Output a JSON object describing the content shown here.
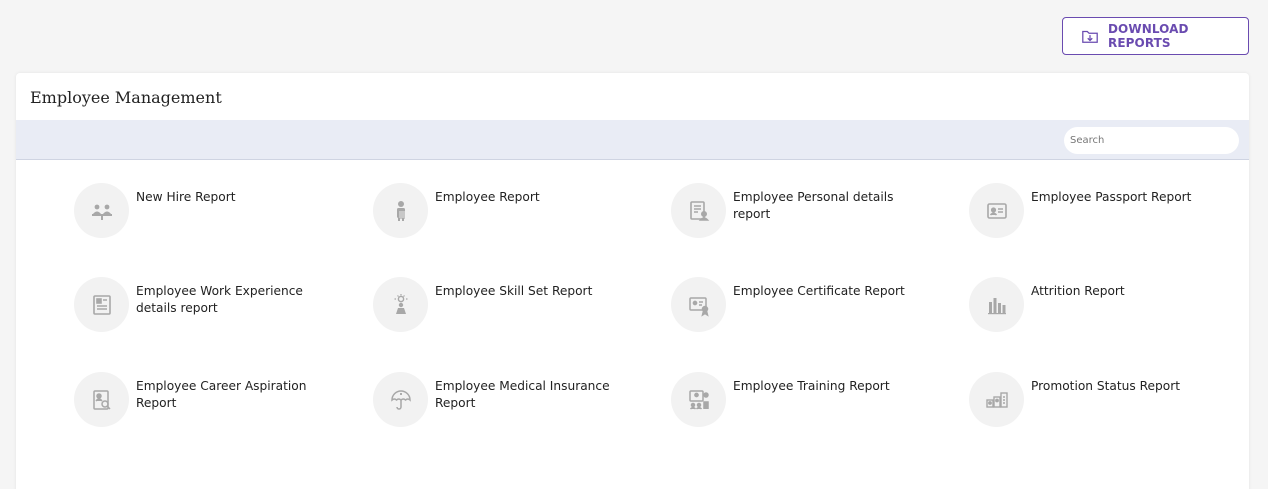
{
  "header": {
    "download_label": "DOWNLOAD REPORTS"
  },
  "card": {
    "title": "Employee Management",
    "search_placeholder": "Search"
  },
  "reports": [
    {
      "label": "New Hire Report",
      "icon": "new-hire-icon"
    },
    {
      "label": "Employee Report",
      "icon": "employee-icon"
    },
    {
      "label": "Employee Personal details report",
      "icon": "personal-details-icon"
    },
    {
      "label": "Employee Passport Report",
      "icon": "passport-icon"
    },
    {
      "label": "Employee Work Experience details report",
      "icon": "work-experience-icon"
    },
    {
      "label": "Employee Skill Set Report",
      "icon": "skill-set-icon"
    },
    {
      "label": "Employee Certificate Report",
      "icon": "certificate-icon"
    },
    {
      "label": "Attrition Report",
      "icon": "attrition-chart-icon"
    },
    {
      "label": "Employee Career Aspiration Report",
      "icon": "career-aspiration-icon"
    },
    {
      "label": "Employee Medical Insurance Report",
      "icon": "medical-insurance-icon"
    },
    {
      "label": "Employee Training Report",
      "icon": "training-icon"
    },
    {
      "label": "Promotion Status Report",
      "icon": "promotion-status-icon"
    }
  ],
  "colors": {
    "accent": "#6a4bb0",
    "search_bar": "#e9ecf5",
    "icon_circle": "#f2f2f2",
    "icon_gray": "#a8a8a8"
  }
}
